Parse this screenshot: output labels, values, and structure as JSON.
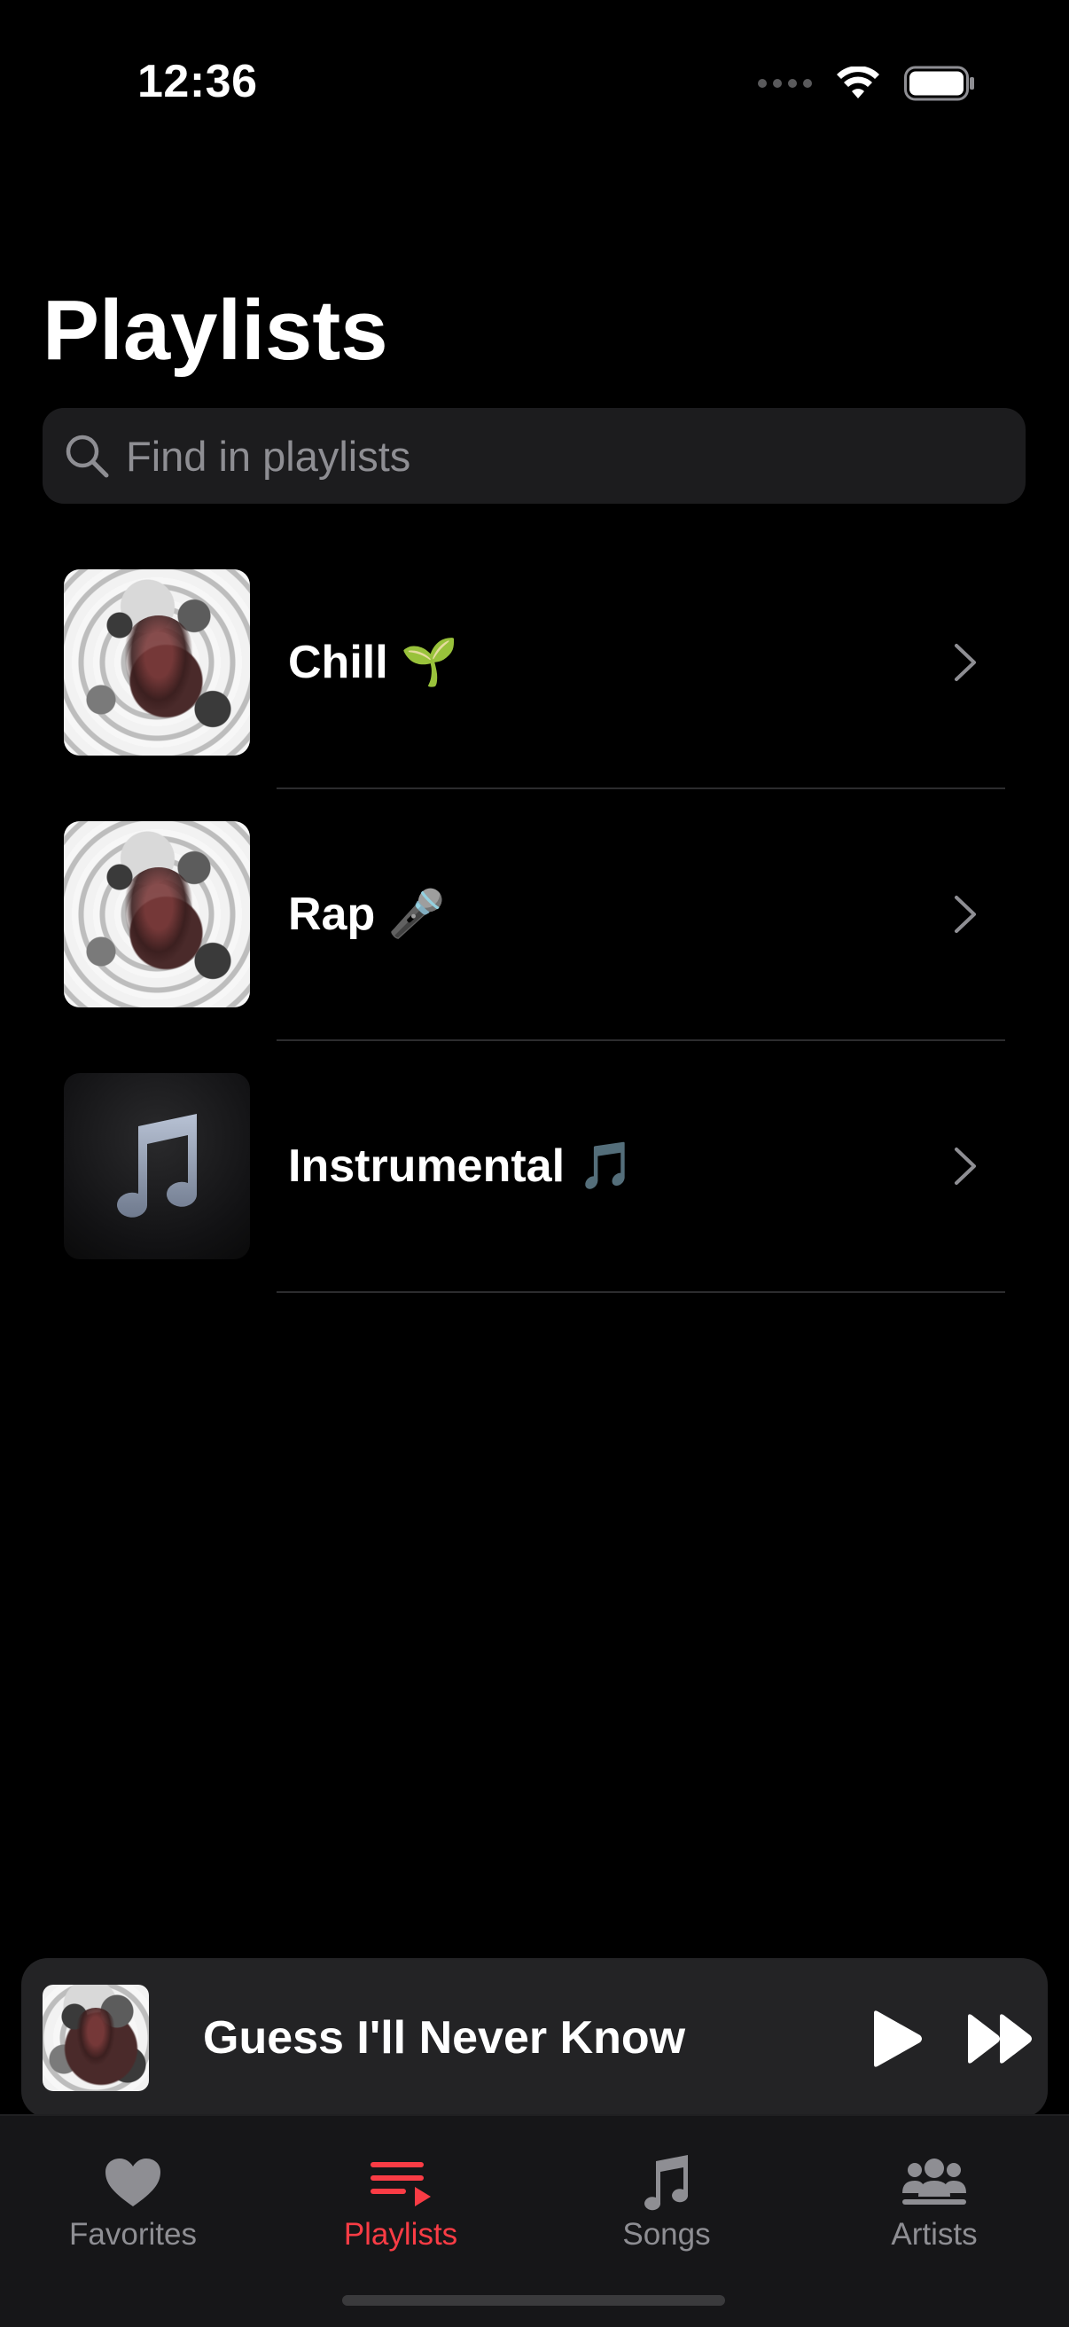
{
  "status_bar": {
    "time": "12:36"
  },
  "page": {
    "title": "Playlists"
  },
  "search": {
    "placeholder": "Find in playlists",
    "value": ""
  },
  "playlists": [
    {
      "name": "Chill 🌱",
      "artwork": "abstract-art"
    },
    {
      "name": "Rap 🎤",
      "artwork": "abstract-art"
    },
    {
      "name": "Instrumental 🎵",
      "artwork": "music-note-placeholder"
    }
  ],
  "mini_player": {
    "track_title": "Guess I'll Never Know"
  },
  "tab_bar": {
    "tabs": [
      {
        "label": "Favorites",
        "icon": "heart-icon"
      },
      {
        "label": "Playlists",
        "icon": "playlist-icon"
      },
      {
        "label": "Songs",
        "icon": "music-note-icon"
      },
      {
        "label": "Artists",
        "icon": "people-icon"
      }
    ],
    "active_tab": "Playlists"
  },
  "colors": {
    "background": "#000000",
    "accent": "#fa3c45",
    "inactive": "#8e8e93",
    "surface": "#1c1c1e"
  }
}
